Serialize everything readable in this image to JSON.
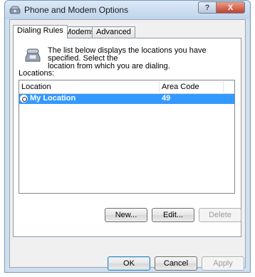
{
  "window": {
    "title": "Phone and Modem Options"
  },
  "title_buttons": {
    "help": "?",
    "close": "X"
  },
  "tabs": [
    {
      "label": "Dialing Rules",
      "active": true
    },
    {
      "label": "Modems",
      "active": false
    },
    {
      "label": "Advanced",
      "active": false
    }
  ],
  "dialing": {
    "info_line1": "The list below displays the locations you have specified. Select the",
    "info_line2": "location from which you are dialing.",
    "locations_label": "Locations:",
    "columns": {
      "location": "Location",
      "area_code": "Area Code"
    },
    "rows": [
      {
        "location": "My Location",
        "area_code": "49",
        "selected": true
      }
    ],
    "buttons": {
      "new": "New...",
      "edit": "Edit...",
      "delete": "Delete"
    }
  },
  "footer": {
    "ok": "OK",
    "cancel": "Cancel",
    "apply": "Apply"
  },
  "colors": {
    "selection": "#3399ff",
    "title_gradient": "#bfd3ea",
    "close_button": "#c2412a"
  },
  "icons": [
    "phone-modem-icon",
    "help-icon",
    "close-icon",
    "telephone-icon",
    "location-radio-icon"
  ]
}
